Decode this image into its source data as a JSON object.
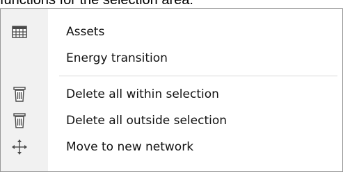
{
  "caption": {
    "text": "functions for the selection area:"
  },
  "menu": {
    "items": [
      {
        "label": "Assets",
        "icon": "grid-table-icon"
      },
      {
        "label": "Energy transition",
        "icon": ""
      },
      {
        "label": "Delete all within selection",
        "icon": "trash-bin-icon"
      },
      {
        "label": "Delete all outside selection",
        "icon": "trash-bin-icon"
      },
      {
        "label": "Move to new network",
        "icon": "move-arrows-icon"
      }
    ]
  }
}
